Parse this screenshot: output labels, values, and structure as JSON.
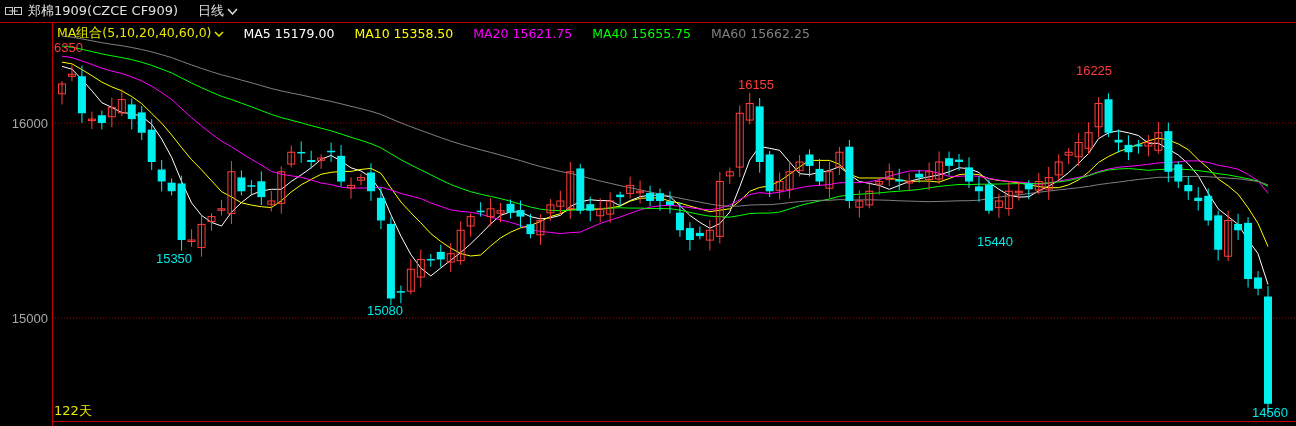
{
  "header": {
    "title": "郑棉1909(CZCE CF909)",
    "period": "日线"
  },
  "legend": {
    "group": "MA组合(5,10,20,40,60,0)",
    "items": [
      {
        "label": "MA5 15179.00",
        "color": "#ffffff"
      },
      {
        "label": "MA10 15358.50",
        "color": "#ffff00"
      },
      {
        "label": "MA20 15621.75",
        "color": "#ff00ff"
      },
      {
        "label": "MA40 15655.75",
        "color": "#00ff00"
      },
      {
        "label": "MA60 15662.25",
        "color": "#808080"
      }
    ]
  },
  "y_axis": [
    "16000",
    "15000"
  ],
  "price_labels": [
    {
      "text": "6350",
      "kind": "high"
    },
    {
      "text": "15350",
      "kind": "low"
    },
    {
      "text": "15080",
      "kind": "low"
    },
    {
      "text": "16155",
      "kind": "high"
    },
    {
      "text": "15440",
      "kind": "low"
    },
    {
      "text": "16225",
      "kind": "high"
    },
    {
      "text": "14560",
      "kind": "low"
    }
  ],
  "day_count": "122天"
}
